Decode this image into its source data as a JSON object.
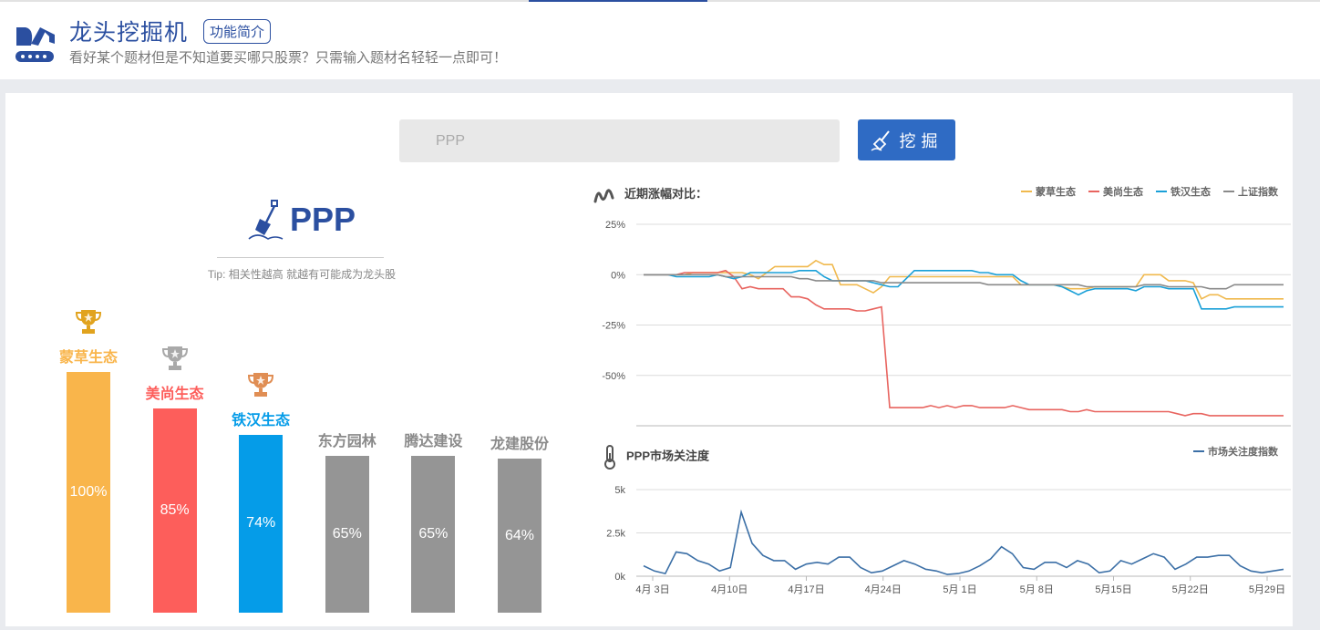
{
  "header": {
    "title": "龙头挖掘机",
    "badge": "功能简介",
    "subtitle": "看好某个题材但是不知道要买哪只股票？只需输入题材名轻轻一点即可！"
  },
  "search": {
    "placeholder": "PPP",
    "button_label": "挖掘"
  },
  "theme": {
    "name": "PPP",
    "tip": "Tip:  相关性越高   就越有可能成为龙头股"
  },
  "ranking": [
    {
      "name": "蒙草生态",
      "value": 100,
      "label": "100%",
      "color": "#f9b54b",
      "trophy": "gold"
    },
    {
      "name": "美尚生态",
      "value": 85,
      "label": "85%",
      "color": "#fd5e5b",
      "trophy": "silver"
    },
    {
      "name": "铁汉生态",
      "value": 74,
      "label": "74%",
      "color": "#059ce8",
      "trophy": "bronze"
    },
    {
      "name": "东方园林",
      "value": 65,
      "label": "65%",
      "color": "#959595",
      "trophy": ""
    },
    {
      "name": "腾达建设",
      "value": 65,
      "label": "65%",
      "color": "#959595",
      "trophy": ""
    },
    {
      "name": "龙建股份",
      "value": 64,
      "label": "64%",
      "color": "#959595",
      "trophy": ""
    }
  ],
  "chart_data": [
    {
      "type": "line",
      "title": "近期涨幅对比：",
      "ylim": [
        -75,
        25
      ],
      "yticks": [
        25,
        0,
        -25,
        -50
      ],
      "ytick_labels": [
        "25%",
        "0%",
        "-25%",
        "-50%"
      ],
      "grid": true,
      "legend_position": "top-right",
      "series": [
        {
          "name": "蒙草生态",
          "color": "#f0b94e",
          "values": [
            0,
            0,
            0,
            0,
            0,
            0,
            1,
            1,
            1,
            1,
            1,
            1,
            1,
            0,
            -2,
            1,
            4,
            4,
            4,
            4,
            4,
            7,
            5,
            5,
            -5,
            -5,
            -5,
            -7,
            -9,
            -6,
            -1,
            -1,
            -1,
            -1,
            -1,
            -1,
            -1,
            -1,
            -1,
            -1,
            -1,
            -1,
            -1,
            -1,
            -1,
            -1,
            -5,
            -5,
            -5,
            -5,
            -5,
            -6,
            -7,
            -7,
            -7,
            -6,
            -6,
            -6,
            -6,
            -6,
            -6,
            0,
            0,
            0,
            -3,
            -3,
            -3,
            -4,
            -12,
            -10,
            -10,
            -12,
            -12,
            -12,
            -12,
            -12,
            -12,
            -12,
            -12
          ]
        },
        {
          "name": "美尚生态",
          "color": "#e8645f",
          "values": [
            0,
            0,
            0,
            0,
            0,
            1,
            1,
            1,
            1,
            1,
            2,
            -1,
            -7,
            -6,
            -7,
            -7,
            -7,
            -7,
            -11,
            -11,
            -12,
            -15,
            -17,
            -17,
            -17,
            -17,
            -18,
            -18,
            -17,
            -16,
            -66,
            -66,
            -66,
            -66,
            -66,
            -65,
            -66,
            -65,
            -66,
            -65,
            -65,
            -66,
            -66,
            -66,
            -66,
            -65,
            -66,
            -67,
            -67,
            -67,
            -67,
            -67,
            -68,
            -68,
            -67,
            -68,
            -68,
            -68,
            -68,
            -68,
            -68,
            -68,
            -68,
            -68,
            -68,
            -69,
            -70,
            -69,
            -69,
            -70,
            -70,
            -70,
            -70,
            -70,
            -70,
            -70,
            -70,
            -70,
            -70
          ]
        },
        {
          "name": "铁汉生态",
          "color": "#1aa0d8",
          "values": [
            0,
            0,
            0,
            0,
            -1,
            -1,
            -1,
            -1,
            -1,
            0,
            -1,
            -2,
            -1,
            1,
            1,
            1,
            1,
            1,
            1,
            2,
            2,
            2,
            -1,
            -3,
            -3,
            -3,
            -3,
            -3,
            -4,
            -5,
            -6,
            -6,
            -2,
            2,
            2,
            2,
            2,
            2,
            2,
            2,
            2,
            1,
            1,
            0,
            0,
            0,
            -3,
            -5,
            -5,
            -5,
            -5,
            -6,
            -8,
            -10,
            -8,
            -7,
            -7,
            -7,
            -7,
            -7,
            -8,
            -6,
            -6,
            -6,
            -7,
            -7,
            -7,
            -7,
            -17,
            -17,
            -17,
            -17,
            -16,
            -16,
            -16,
            -16,
            -16,
            -16,
            -16
          ]
        },
        {
          "name": "上证指数",
          "color": "#8a8a8a",
          "values": [
            0,
            0,
            0,
            0,
            0,
            0,
            0,
            0,
            0,
            0,
            -1,
            -1,
            -1,
            -1,
            -1,
            -1,
            -1,
            -1,
            -1,
            -2,
            -2,
            -3,
            -3,
            -3,
            -3,
            -3,
            -3,
            -3,
            -3,
            -4,
            -4,
            -4,
            -4,
            -4,
            -4,
            -4,
            -4,
            -4,
            -4,
            -4,
            -4,
            -4,
            -5,
            -5,
            -5,
            -5,
            -5,
            -5,
            -5,
            -5,
            -5,
            -5,
            -5,
            -5,
            -6,
            -6,
            -6,
            -6,
            -6,
            -6,
            -6,
            -5,
            -5,
            -5,
            -6,
            -6,
            -6,
            -6,
            -6,
            -7,
            -7,
            -7,
            -5,
            -5,
            -5,
            -5,
            -5,
            -5,
            -5
          ]
        }
      ]
    },
    {
      "type": "line",
      "title": "PPP市场关注度",
      "ylim": [
        0,
        5000
      ],
      "yticks": [
        5000,
        2500,
        0
      ],
      "ytick_labels": [
        "5k",
        "2.5k",
        "0k"
      ],
      "grid": true,
      "legend_position": "top-right",
      "xtick_labels": [
        "4月 3日",
        "4月10日",
        "4月17日",
        "4月24日",
        "5月 1日",
        "5月 8日",
        "5月15日",
        "5月22日",
        "5月29日"
      ],
      "series": [
        {
          "name": "市场关注度指数",
          "color": "#3b6fa6",
          "values": [
            600,
            300,
            150,
            1400,
            1300,
            900,
            700,
            300,
            500,
            3700,
            1900,
            1200,
            900,
            900,
            400,
            700,
            800,
            700,
            1100,
            1100,
            500,
            200,
            300,
            600,
            900,
            700,
            400,
            300,
            100,
            150,
            300,
            600,
            1000,
            1700,
            1300,
            500,
            400,
            800,
            800,
            500,
            900,
            700,
            200,
            300,
            900,
            700,
            1000,
            1300,
            1100,
            400,
            700,
            1100,
            1100,
            1200,
            1200,
            600,
            300,
            200,
            300,
            400
          ]
        }
      ]
    }
  ]
}
